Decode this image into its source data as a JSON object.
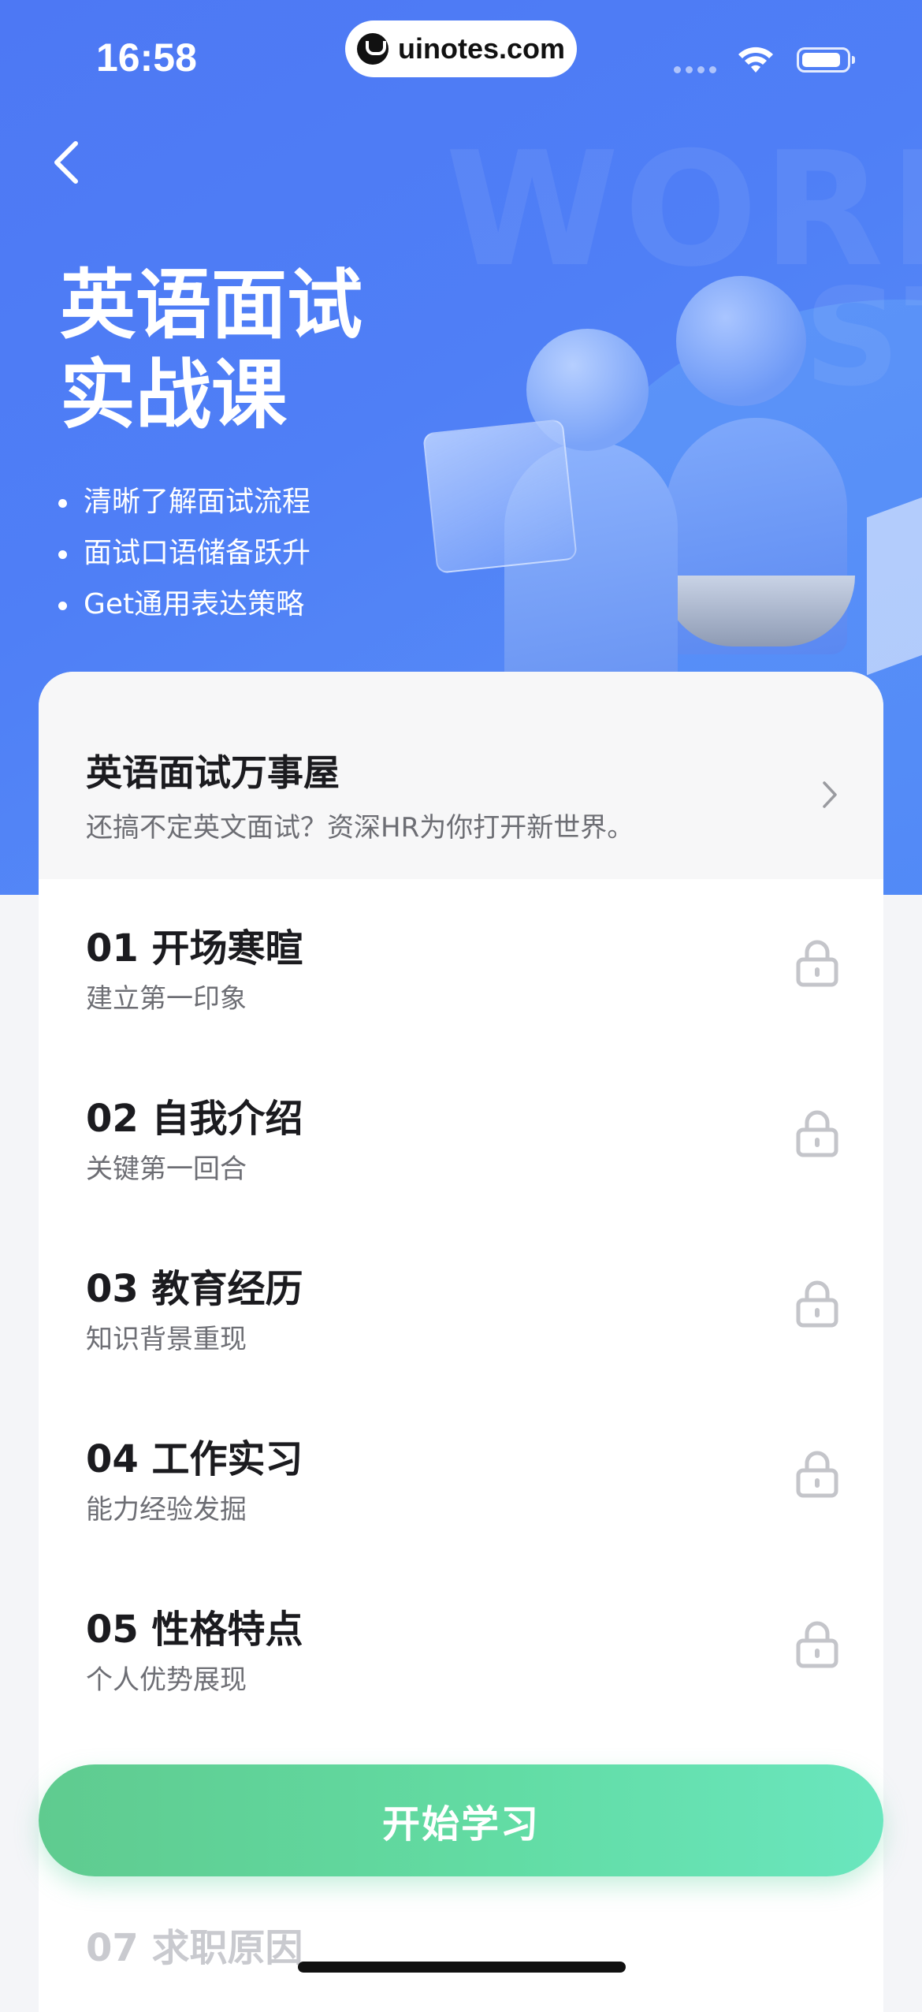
{
  "status_bar": {
    "time": "16:58",
    "site": "uinotes.com"
  },
  "hero": {
    "watermark_1": "WORD",
    "watermark_2": "ST",
    "title_line_1": "英语面试",
    "title_line_2": "实战课",
    "bullets": [
      "清晰了解面试流程",
      "面试口语储备跃升",
      "Get通用表达策略"
    ]
  },
  "featured": {
    "title": "英语面试万事屋",
    "subtitle": "还搞不定英文面试？资深HR为你打开新世界。"
  },
  "lessons": [
    {
      "title": "01 开场寒暄",
      "subtitle": "建立第一印象"
    },
    {
      "title": "02 自我介绍",
      "subtitle": "关键第一回合"
    },
    {
      "title": "03 教育经历",
      "subtitle": "知识背景重现"
    },
    {
      "title": "04 工作实习",
      "subtitle": "能力经验发掘"
    },
    {
      "title": "05 性格特点",
      "subtitle": "个人优势展现"
    },
    {
      "title": "07 求职原因",
      "subtitle": ""
    }
  ],
  "start_button": {
    "label": "开始学习"
  },
  "colors": {
    "hero_blue": "#4f7ff6",
    "button_green_start": "#5fcb8f",
    "button_green_end": "#6ae6be"
  }
}
